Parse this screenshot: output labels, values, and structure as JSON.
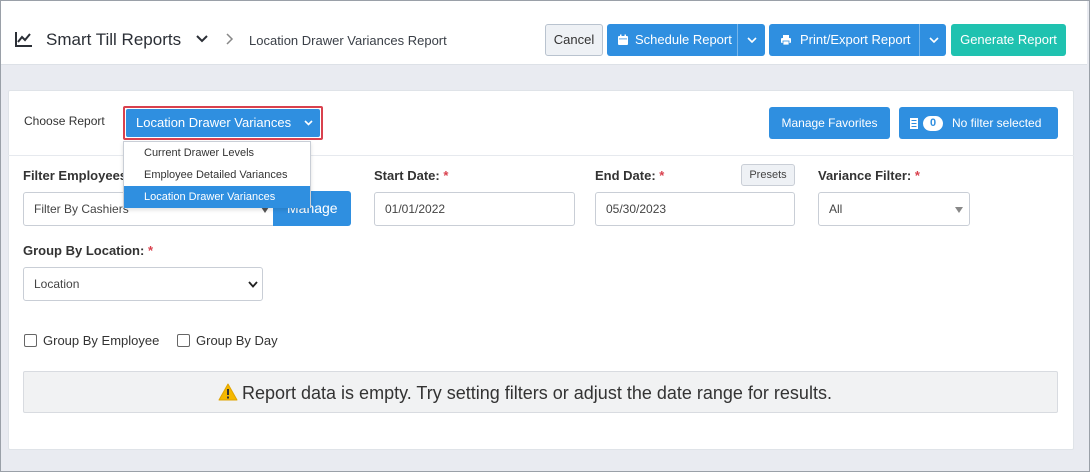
{
  "header": {
    "app_title": "Smart Till Reports",
    "breadcrumb": "Location Drawer Variances Report",
    "buttons": {
      "cancel": "Cancel",
      "schedule": "Schedule Report",
      "print_export": "Print/Export Report",
      "generate": "Generate Report"
    }
  },
  "report_chooser": {
    "label": "Choose Report",
    "selected": "Location Drawer Variances",
    "options": [
      "Current Drawer Levels",
      "Employee Detailed Variances",
      "Location Drawer Variances"
    ],
    "active_index": 2
  },
  "toolbar": {
    "manage_favorites": "Manage Favorites",
    "filter_count": "0",
    "filter_text": "No filter selected"
  },
  "filters": {
    "employees": {
      "label": "Filter Employees",
      "value": "Filter By Cashiers",
      "button": "Manage"
    },
    "start_date": {
      "label": "Start Date:",
      "required": "*",
      "value": "01/01/2022"
    },
    "end_date": {
      "label": "End Date:",
      "required": "*",
      "value": "05/30/2023",
      "presets": "Presets"
    },
    "variance": {
      "label": "Variance Filter:",
      "required": "*",
      "value": "All"
    },
    "group_by_location": {
      "label": "Group By Location:",
      "required": "*",
      "value": "Location"
    },
    "checkboxes": [
      {
        "label": "Group By Employee",
        "checked": false
      },
      {
        "label": "Group By Day",
        "checked": false
      }
    ]
  },
  "empty_message": "Report data is empty. Try setting filters or adjust the date range for results.",
  "colors": {
    "primary": "#2f8fe0",
    "teal": "#1fc2b0",
    "required": "#d9414e",
    "warning": "#f5b800"
  }
}
